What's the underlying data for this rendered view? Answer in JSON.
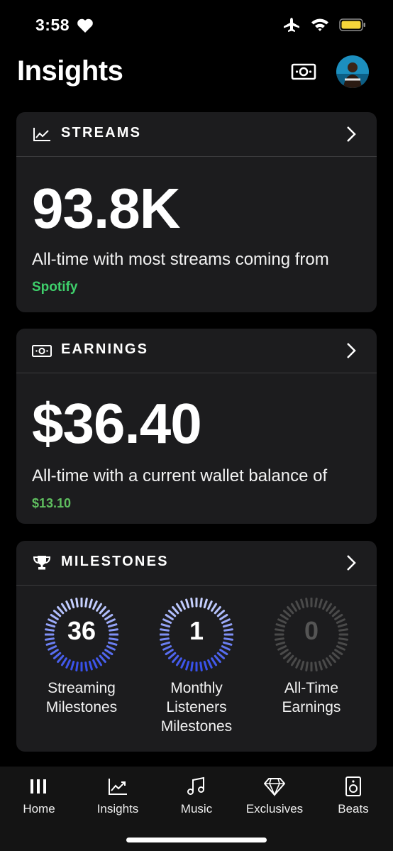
{
  "status_bar": {
    "time": "3:58"
  },
  "header": {
    "title": "Insights"
  },
  "streams": {
    "title": "STREAMS",
    "value": "93.8K",
    "desc": "All-time with most streams coming from",
    "source": "Spotify"
  },
  "earnings": {
    "title": "EARNINGS",
    "value": "$36.40",
    "desc": "All-time with a current wallet balance of",
    "balance": "$13.10"
  },
  "milestones": {
    "title": "MILESTONES",
    "items": [
      {
        "value": "36",
        "line1": "Streaming",
        "line2": "Milestones",
        "line3": "",
        "color": "#3d5cf5",
        "active": true
      },
      {
        "value": "1",
        "line1": "Monthly",
        "line2": "Listeners",
        "line3": "Milestones",
        "color": "#3d5cf5",
        "active": true
      },
      {
        "value": "0",
        "line1": "All-Time",
        "line2": "Earnings",
        "line3": "",
        "color": "#4a4a4a",
        "active": false
      }
    ]
  },
  "nav": [
    {
      "label": "Home",
      "icon": "home-icon"
    },
    {
      "label": "Insights",
      "icon": "chart-icon"
    },
    {
      "label": "Music",
      "icon": "music-note-icon"
    },
    {
      "label": "Exclusives",
      "icon": "diamond-icon"
    },
    {
      "label": "Beats",
      "icon": "speaker-icon"
    }
  ],
  "colors": {
    "accent_green": "#3ecf6b",
    "ring_blue": "#3d5cf5",
    "card_bg": "#1c1c1e"
  }
}
